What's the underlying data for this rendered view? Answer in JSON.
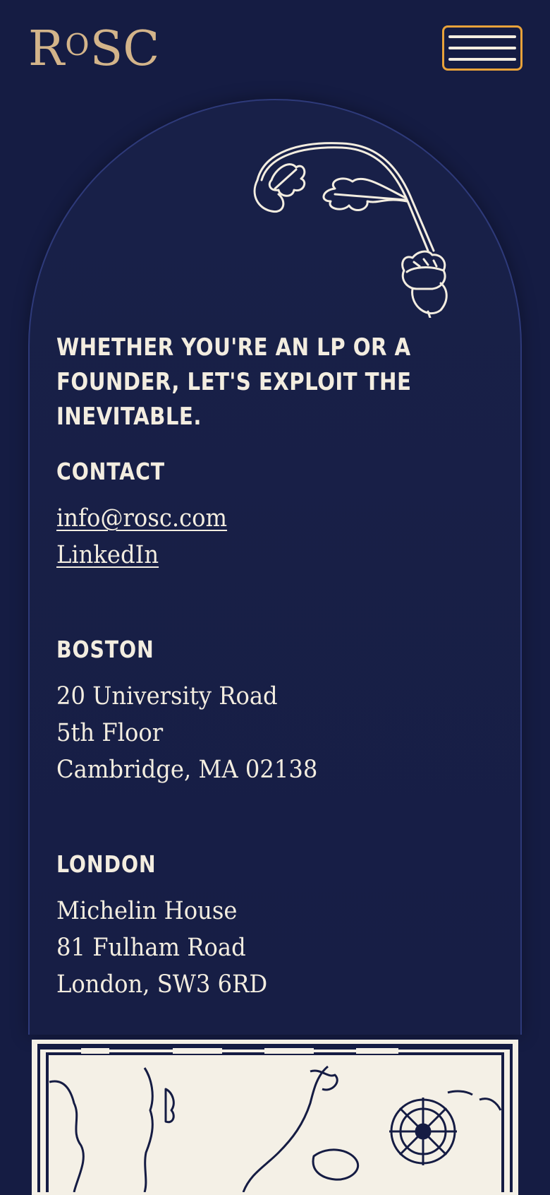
{
  "brand": {
    "logo_text_r": "R",
    "logo_text_o": "O",
    "logo_text_sc": "SC"
  },
  "menu": {
    "label": "Menu"
  },
  "tagline": "WHETHER YOU'RE AN LP OR A FOUNDER, LET'S EXPLOIT THE INEVITABLE.",
  "contact": {
    "heading": "CONTACT",
    "email": "info@rosc.com",
    "linkedin": "LinkedIn"
  },
  "boston": {
    "heading": "BOSTON",
    "lines": [
      "20 University Road",
      "5th Floor",
      "Cambridge, MA 02138"
    ]
  },
  "london": {
    "heading": "LONDON",
    "lines": [
      "Michelin House",
      "81 Fulham Road",
      "London, SW3 6RD"
    ]
  },
  "colors": {
    "background": "#151c43",
    "accent_gold": "#d3b48a",
    "button_border": "#e8a23a",
    "text": "#f3ede0"
  },
  "icons": [
    "acorn-illustration-icon",
    "hamburger-menu-icon",
    "map-illustration-icon",
    "compass-rose-icon"
  ]
}
